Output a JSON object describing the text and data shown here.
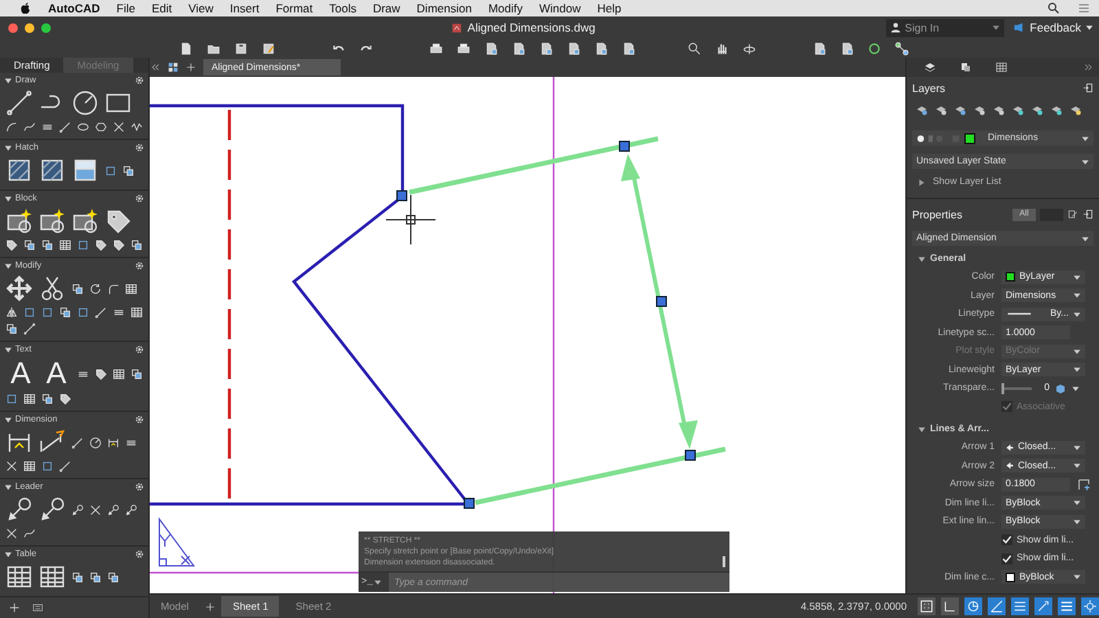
{
  "menu_bar": {
    "app_name": "AutoCAD",
    "items": [
      "File",
      "Edit",
      "View",
      "Insert",
      "Format",
      "Tools",
      "Draw",
      "Dimension",
      "Modify",
      "Window",
      "Help"
    ]
  },
  "title_bar": {
    "title": "Aligned Dimensions.dwg",
    "sign_in": {
      "placeholder": "Sign In"
    },
    "feedback": "Feedback"
  },
  "workspace_tabs": [
    {
      "label": "Drafting",
      "selected": true
    },
    {
      "label": "Modeling",
      "selected": false
    }
  ],
  "file_tabs": [
    {
      "label": "Aligned Dimensions*",
      "selected": true
    }
  ],
  "tool_palette": {
    "sections": [
      {
        "title": "Draw"
      },
      {
        "title": "Hatch"
      },
      {
        "title": "Block"
      },
      {
        "title": "Modify"
      },
      {
        "title": "Text",
        "glyphs": [
          "A",
          "A"
        ]
      },
      {
        "title": "Dimension"
      },
      {
        "title": "Leader"
      },
      {
        "title": "Table"
      }
    ]
  },
  "layers": {
    "title": "Layers",
    "current_layer": {
      "name": "Dimensions",
      "color": "#22dd22"
    },
    "layer_state": "Unsaved Layer State",
    "show_list": "Show Layer List"
  },
  "properties": {
    "title": "Properties",
    "filters": [
      {
        "label": "All",
        "selected": true
      },
      {
        "selected": false
      }
    ],
    "object_type": "Aligned Dimension",
    "sections": [
      {
        "title": "General",
        "expanded": true,
        "rows": [
          {
            "kind": "dropdown",
            "label": "Color",
            "value": "ByLayer",
            "color": "#22dd22",
            "disabled": false
          },
          {
            "kind": "dropdown",
            "label": "Layer",
            "value": "Dimensions",
            "disabled": false
          },
          {
            "kind": "linetype",
            "label": "Linetype",
            "value": "By...",
            "disabled": false
          },
          {
            "kind": "input",
            "label": "Linetype sc...",
            "value": "1.0000",
            "disabled": false
          },
          {
            "kind": "dropdown",
            "label": "Plot style",
            "value": "ByColor",
            "disabled": true
          },
          {
            "kind": "dropdown",
            "label": "Lineweight",
            "value": "ByLayer",
            "disabled": false
          },
          {
            "kind": "slider",
            "label": "Transpare...",
            "value": "0",
            "level": 0,
            "disabled": false
          },
          {
            "kind": "checkbox",
            "value": "Associative",
            "checked": true,
            "disabled": true
          }
        ]
      },
      {
        "title": "Lines & Arr...",
        "expanded": true,
        "rows": [
          {
            "kind": "arrow",
            "label": "Arrow 1",
            "value": "Closed...",
            "disabled": false
          },
          {
            "kind": "arrow",
            "label": "Arrow 2",
            "value": "Closed...",
            "disabled": false
          },
          {
            "kind": "input_pick",
            "label": "Arrow size",
            "value": "0.1800",
            "disabled": false
          },
          {
            "kind": "dropdown",
            "label": "Dim line li...",
            "value": "ByBlock",
            "disabled": false
          },
          {
            "kind": "dropdown",
            "label": "Ext line lin...",
            "value": "ByBlock",
            "disabled": false
          },
          {
            "kind": "checkbox",
            "value": "Show dim li...",
            "checked": true,
            "disabled": false
          },
          {
            "kind": "checkbox",
            "value": "Show dim li...",
            "checked": true,
            "disabled": false
          },
          {
            "kind": "dropdown",
            "label": "Dim line c...",
            "value": "ByBlock",
            "color": "#ffffff",
            "disabled": false
          }
        ]
      }
    ]
  },
  "command_line": {
    "history": [
      "** STRETCH **",
      "Specify stretch point or [Base point/Copy/Undo/eXit]",
      "Dimension extension disassociated."
    ],
    "prompt": ">_",
    "placeholder": "Type a command"
  },
  "status_bar": {
    "layout_tabs": [
      {
        "label": "Model",
        "selected": false
      },
      {
        "label": "Sheet 1",
        "selected": true
      },
      {
        "label": "Sheet 2",
        "selected": false
      }
    ],
    "coordinates": "4.5858, 2.3797, 0.0000"
  }
}
